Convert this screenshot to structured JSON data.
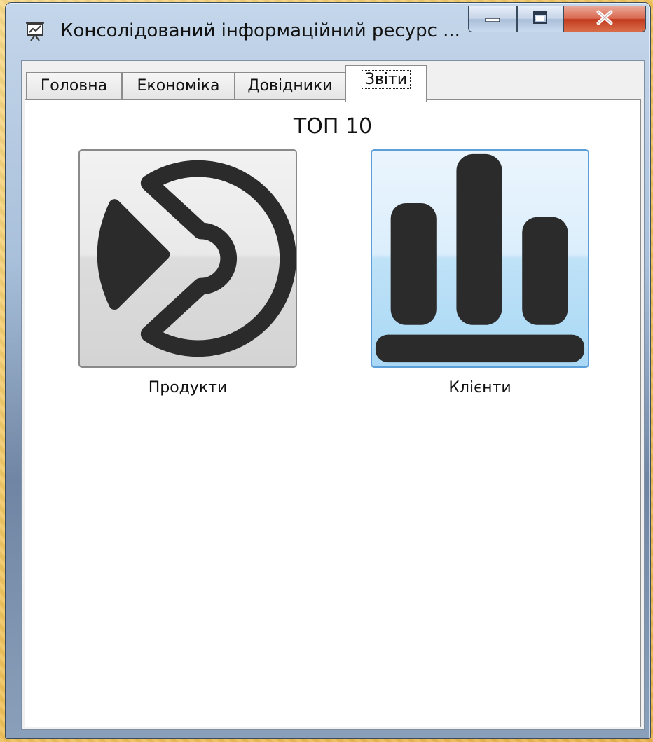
{
  "window": {
    "title": "Консолідований інформаційний ресурс ...",
    "icon": "presentation-chart-icon",
    "controls": {
      "minimize_icon": "minimize-icon",
      "maximize_icon": "maximize-icon",
      "close_icon": "close-icon"
    }
  },
  "tabs": [
    {
      "label": "Головна",
      "active": false
    },
    {
      "label": "Економіка",
      "active": false
    },
    {
      "label": "Довідники",
      "active": false
    },
    {
      "label": "Звіти",
      "active": true
    }
  ],
  "reports": {
    "heading": "ТОП 10",
    "items": [
      {
        "label": "Продукти",
        "icon": "pie-chart-icon",
        "selected": false
      },
      {
        "label": "Клієнти",
        "icon": "bar-chart-icon",
        "selected": true
      }
    ]
  },
  "colors": {
    "accent_selected": "#5d9fd8",
    "icon_dark": "#2b2b2b",
    "close_button": "#c23b1f"
  }
}
